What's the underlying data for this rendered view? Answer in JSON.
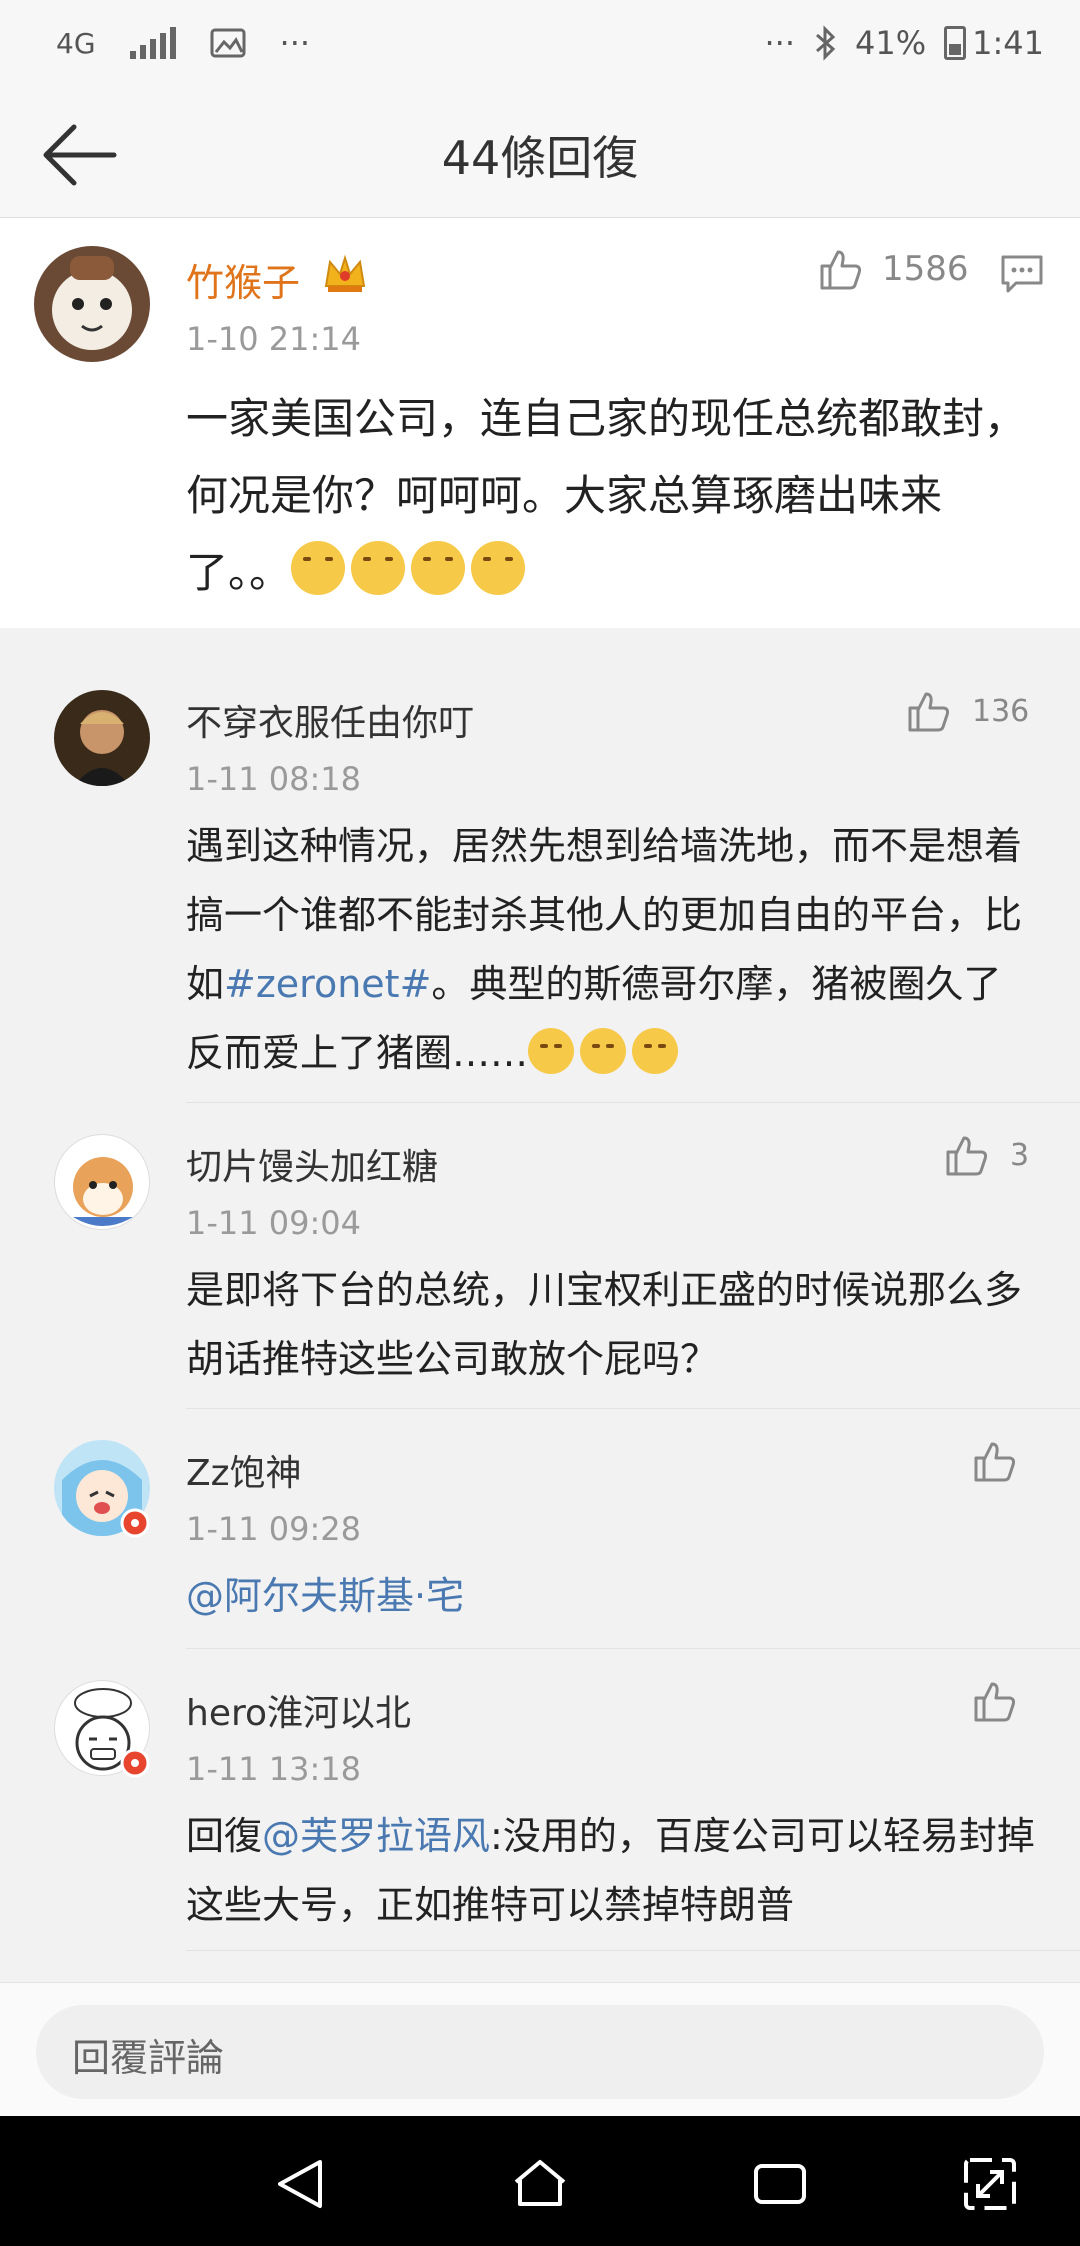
{
  "status_bar": {
    "network": "4G",
    "more_left": "···",
    "more_right": "···",
    "battery": "41%",
    "time": "1:41"
  },
  "header": {
    "title": "44條回復"
  },
  "main_comment": {
    "username": "竹猴子",
    "timestamp": "1-10 21:14",
    "likes": "1586",
    "text": "一家美国公司，连自己家的现任总统都敢封，何况是你？呵呵呵。大家总算琢磨出味来了。。"
  },
  "replies": [
    {
      "username": "不穿衣服任由你叮",
      "timestamp": "1-11 08:18",
      "likes": "136",
      "text_before": "遇到这种情况，居然先想到给墙洗地，而不是想着搞一个谁都不能封杀其他人的更加自由的平台，比如",
      "link": "#zeronet#",
      "text_after": "。典型的斯德哥尔摩，猪被圈久了反而爱上了猪圈……"
    },
    {
      "username": "切片馒头加红糖",
      "timestamp": "1-11 09:04",
      "likes": "3",
      "text": "是即将下台的总统，川宝权利正盛的时候说那么多胡话推特这些公司敢放个屁吗？"
    },
    {
      "username": "Zz饱神",
      "timestamp": "1-11 09:28",
      "likes": "",
      "mention": "@阿尔夫斯基·宅"
    },
    {
      "username": "hero淮河以北",
      "timestamp": "1-11 13:18",
      "likes": "",
      "prefix": "回復",
      "mention": "@芙罗拉语风",
      "text": ":没用的，百度公司可以轻易封掉这些大号，正如推特可以禁掉特朗普"
    }
  ],
  "input": {
    "placeholder": "回覆評論"
  },
  "colors": {
    "username_highlight": "#e0741a",
    "link": "#4a78b0",
    "timestamp": "#9a9a9a"
  }
}
